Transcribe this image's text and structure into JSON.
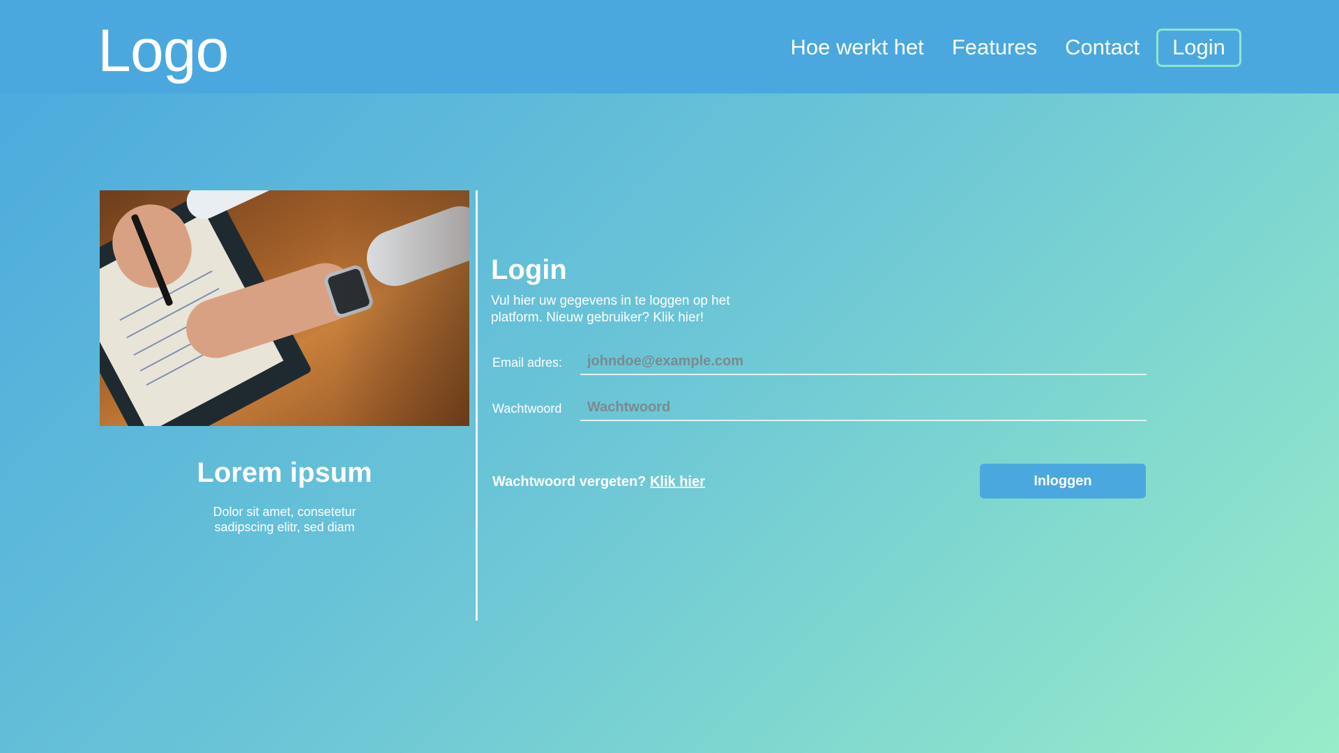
{
  "header": {
    "logo": "Logo",
    "nav": [
      {
        "label": "Hoe werkt het"
      },
      {
        "label": "Features"
      },
      {
        "label": "Contact"
      }
    ],
    "login_label": "Login"
  },
  "left_panel": {
    "photo_icon": "hands-writing-notebook-photo",
    "title": "Lorem ipsum",
    "text": "Dolor sit amet, consetetur sadipscing elitr, sed diam"
  },
  "login_form": {
    "title": "Login",
    "subtitle": "Vul hier uw gegevens in te loggen op het platform. Nieuw gebruiker? Klik hier!",
    "email": {
      "label": "Email adres:",
      "placeholder": "johndoe@example.com",
      "value": ""
    },
    "password": {
      "label": "Wachtwoord",
      "placeholder": "Wachtwoord",
      "value": ""
    },
    "forgot_text": "Wachtwoord vergeten?",
    "forgot_link": "Klik hier",
    "submit_label": "Inloggen"
  },
  "colors": {
    "header_bg": "#4aa8df",
    "gradient_start": "#4aa8de",
    "gradient_end": "#98ecc8",
    "login_button_border": "#8ee6cf",
    "submit_button_bg": "#4aa8df"
  }
}
